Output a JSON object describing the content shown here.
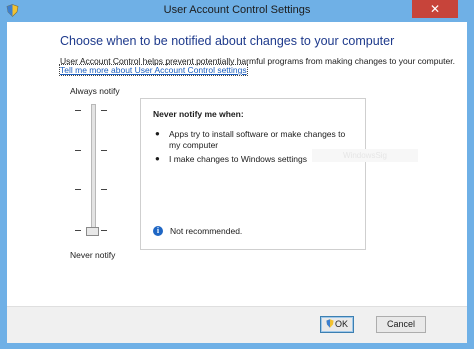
{
  "window": {
    "title": "User Account Control Settings",
    "close_glyph": "✕"
  },
  "main": {
    "heading": "Choose when to be notified about changes to your computer",
    "description": "User Account Control helps prevent potentially harmful programs from making changes to your computer.",
    "link": "Tell me more about User Account Control settings"
  },
  "slider": {
    "top_label": "Always notify",
    "bottom_label": "Never notify",
    "level_count": 4,
    "selected_level": 1
  },
  "info_box": {
    "title": "Never notify me when:",
    "items": [
      "Apps try to install software or make changes to my computer",
      "I make changes to Windows settings"
    ],
    "bullet": "●",
    "note": "Not recommended.",
    "note_icon": "info-icon",
    "watermark": "WindowsSig"
  },
  "buttons": {
    "ok": "OK",
    "cancel": "Cancel",
    "ok_icon": "uac-shield-icon"
  },
  "colors": {
    "frame": "#6fb0e6",
    "heading": "#1e3a8c",
    "link": "#1d5fbf",
    "close": "#c7443a",
    "info": "#1f66c4"
  }
}
